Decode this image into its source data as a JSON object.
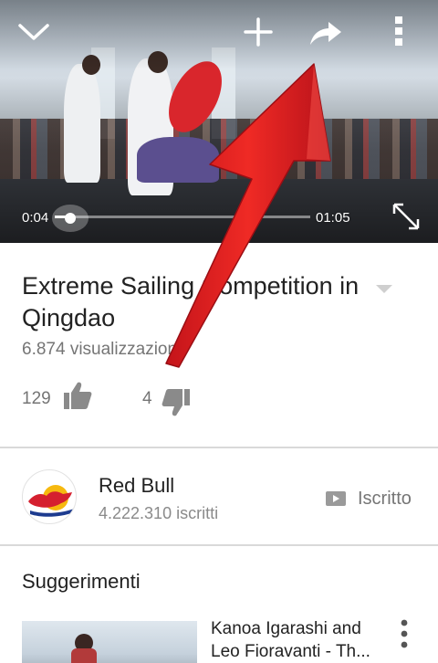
{
  "player": {
    "current_time": "0:04",
    "duration": "01:05",
    "progress": 0.06,
    "icons": [
      "chevron-down-icon",
      "add-icon",
      "share-icon",
      "more-vert-icon",
      "fullscreen-icon"
    ]
  },
  "video": {
    "title": "Extreme Sailing Competition in Qingdao",
    "views": "6.874 visualizzazioni",
    "likes": "129",
    "dislikes": "4"
  },
  "channel": {
    "name": "Red Bull",
    "subscribers": "4.222.310 iscritti",
    "subscribed_label": "Iscritto"
  },
  "suggestions": {
    "heading": "Suggerimenti",
    "items": [
      {
        "title": "Kanoa Igarashi and Leo Fioravanti - Th..."
      }
    ]
  },
  "colors": {
    "annotation_arrow": "#e8231f",
    "secondary_text": "#757575",
    "divider": "#d9d9d9"
  }
}
